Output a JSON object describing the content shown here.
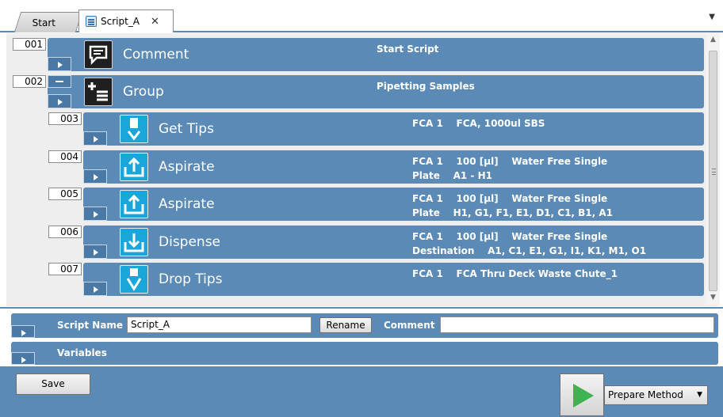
{
  "tabs": [
    {
      "label": "Start"
    },
    {
      "label": "Script_A"
    }
  ],
  "steps": [
    {
      "num": "001",
      "command": "Comment",
      "icon": "comment-icon",
      "desc": "Start Script"
    },
    {
      "num": "002",
      "command": "Group",
      "icon": "group-icon",
      "desc": "Pipetting Samples"
    },
    {
      "num": "003",
      "command": "Get Tips",
      "icon": "get-tips-icon",
      "desc": "FCA 1    FCA, 1000ul SBS"
    },
    {
      "num": "004",
      "command": "Aspirate",
      "icon": "aspirate-icon",
      "desc": "FCA 1    100 [µl]    Water Free Single\nPlate    A1 - H1"
    },
    {
      "num": "005",
      "command": "Aspirate",
      "icon": "aspirate-icon",
      "desc": "FCA 1    100 [µl]    Water Free Single\nPlate    H1, G1, F1, E1, D1, C1, B1, A1"
    },
    {
      "num": "006",
      "command": "Dispense",
      "icon": "dispense-icon",
      "desc": "FCA 1    100 [µl]    Water Free Single\nDestination    A1, C1, E1, G1, I1, K1, M1, O1"
    },
    {
      "num": "007",
      "command": "Drop Tips",
      "icon": "drop-tips-icon",
      "desc": "FCA 1    FCA Thru Deck Waste Chute_1"
    }
  ],
  "properties": {
    "script_name_label": "Script Name",
    "script_name_value": "Script_A",
    "rename_label": "Rename",
    "comment_label": "Comment",
    "comment_value": "",
    "variables_label": "Variables"
  },
  "footer": {
    "save_label": "Save",
    "prepare_label": "Prepare Method"
  },
  "colors": {
    "step_bar": "#5b8ab6",
    "icon_blue": "#1aa6d9",
    "run_green": "#3fb34f"
  }
}
